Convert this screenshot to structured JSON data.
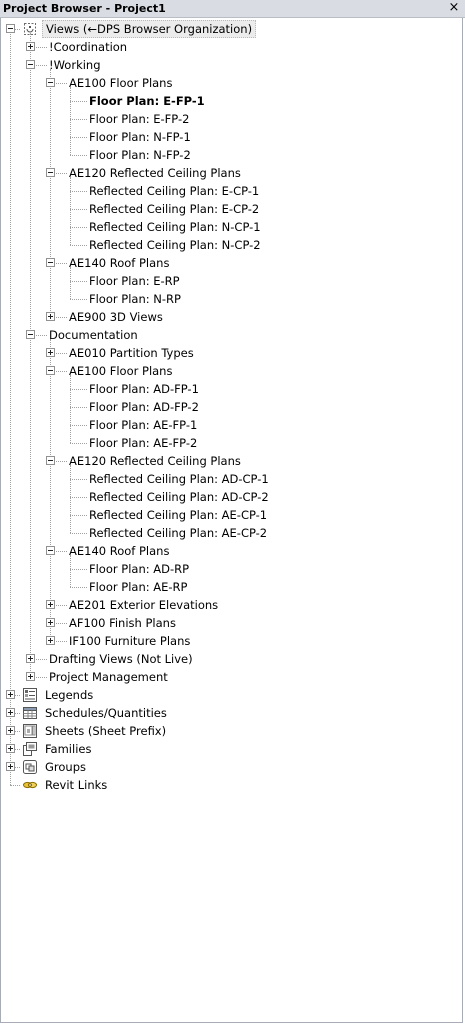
{
  "window": {
    "title": "Project Browser - Project1",
    "close_label": "×"
  },
  "tree": [
    {
      "level": 0,
      "text": "Views (←DPS Browser Organization)",
      "expander": "expanded",
      "icon": "views-icon",
      "selected": true,
      "last": false
    },
    {
      "level": 1,
      "text": "!Coordination",
      "expander": "collapsed",
      "last": false
    },
    {
      "level": 1,
      "text": "!Working",
      "expander": "expanded",
      "last": false
    },
    {
      "level": 2,
      "text": "AE100 Floor Plans",
      "expander": "expanded",
      "last": false
    },
    {
      "level": 3,
      "text": "Floor Plan: E-FP-1",
      "bold": true,
      "last": false
    },
    {
      "level": 3,
      "text": "Floor Plan: E-FP-2",
      "last": false
    },
    {
      "level": 3,
      "text": "Floor Plan: N-FP-1",
      "last": false
    },
    {
      "level": 3,
      "text": "Floor Plan: N-FP-2",
      "last": true
    },
    {
      "level": 2,
      "text": "AE120 Reflected Ceiling Plans",
      "expander": "expanded",
      "last": false
    },
    {
      "level": 3,
      "text": "Reflected Ceiling Plan: E-CP-1",
      "last": false
    },
    {
      "level": 3,
      "text": "Reflected Ceiling Plan: E-CP-2",
      "last": false
    },
    {
      "level": 3,
      "text": "Reflected Ceiling Plan: N-CP-1",
      "last": false
    },
    {
      "level": 3,
      "text": "Reflected Ceiling Plan: N-CP-2",
      "last": true
    },
    {
      "level": 2,
      "text": "AE140 Roof Plans",
      "expander": "expanded",
      "last": false
    },
    {
      "level": 3,
      "text": "Floor Plan: E-RP",
      "last": false
    },
    {
      "level": 3,
      "text": "Floor Plan: N-RP",
      "last": true
    },
    {
      "level": 2,
      "text": "AE900 3D Views",
      "expander": "collapsed",
      "last": true
    },
    {
      "level": 1,
      "text": "Documentation",
      "expander": "expanded",
      "last": false
    },
    {
      "level": 2,
      "text": "AE010 Partition Types",
      "expander": "collapsed",
      "last": false
    },
    {
      "level": 2,
      "text": "AE100 Floor Plans",
      "expander": "expanded",
      "last": false
    },
    {
      "level": 3,
      "text": "Floor Plan: AD-FP-1",
      "last": false
    },
    {
      "level": 3,
      "text": "Floor Plan: AD-FP-2",
      "last": false
    },
    {
      "level": 3,
      "text": "Floor Plan: AE-FP-1",
      "last": false
    },
    {
      "level": 3,
      "text": "Floor Plan: AE-FP-2",
      "last": true
    },
    {
      "level": 2,
      "text": "AE120 Reflected Ceiling Plans",
      "expander": "expanded",
      "last": false
    },
    {
      "level": 3,
      "text": "Reflected Ceiling Plan: AD-CP-1",
      "last": false
    },
    {
      "level": 3,
      "text": "Reflected Ceiling Plan: AD-CP-2",
      "last": false
    },
    {
      "level": 3,
      "text": "Reflected Ceiling Plan: AE-CP-1",
      "last": false
    },
    {
      "level": 3,
      "text": "Reflected Ceiling Plan: AE-CP-2",
      "last": true
    },
    {
      "level": 2,
      "text": "AE140 Roof Plans",
      "expander": "expanded",
      "last": false
    },
    {
      "level": 3,
      "text": "Floor Plan: AD-RP",
      "last": false
    },
    {
      "level": 3,
      "text": "Floor Plan: AE-RP",
      "last": true
    },
    {
      "level": 2,
      "text": "AE201 Exterior Elevations",
      "expander": "collapsed",
      "last": false
    },
    {
      "level": 2,
      "text": "AF100 Finish Plans",
      "expander": "collapsed",
      "last": false
    },
    {
      "level": 2,
      "text": "IF100 Furniture Plans",
      "expander": "collapsed",
      "last": true
    },
    {
      "level": 1,
      "text": "Drafting Views (Not Live)",
      "expander": "collapsed",
      "last": false
    },
    {
      "level": 1,
      "text": "Project Management",
      "expander": "collapsed",
      "last": true
    },
    {
      "level": 0,
      "text": "Legends",
      "expander": "collapsed",
      "icon": "legends-icon",
      "last": false
    },
    {
      "level": 0,
      "text": "Schedules/Quantities",
      "expander": "collapsed",
      "icon": "schedules-icon",
      "last": false
    },
    {
      "level": 0,
      "text": "Sheets (Sheet Prefix)",
      "expander": "collapsed",
      "icon": "sheets-icon",
      "last": false
    },
    {
      "level": 0,
      "text": "Families",
      "expander": "collapsed",
      "icon": "families-icon",
      "last": false
    },
    {
      "level": 0,
      "text": "Groups",
      "expander": "collapsed",
      "icon": "groups-icon",
      "last": false
    },
    {
      "level": 0,
      "text": "Revit Links",
      "icon": "revit-links-icon",
      "last": true
    }
  ]
}
